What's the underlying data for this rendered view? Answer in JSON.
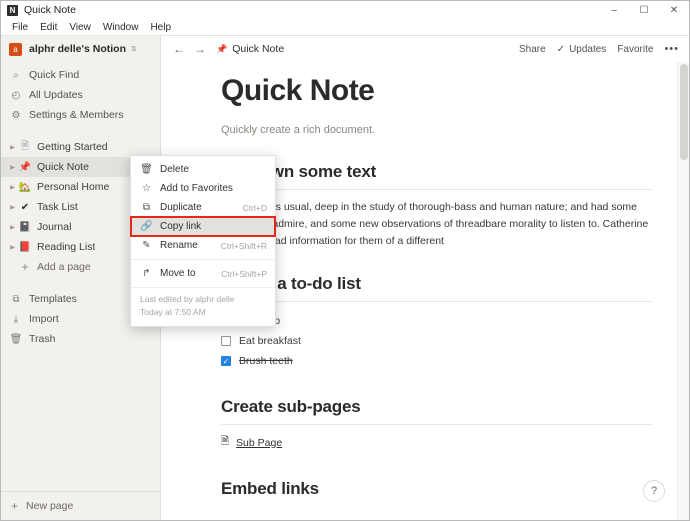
{
  "window": {
    "title": "Quick Note",
    "app_icon": "notion-logo-icon",
    "minimize": "–",
    "maximize": "☐",
    "close": "✕"
  },
  "menubar": {
    "items": [
      "File",
      "Edit",
      "View",
      "Window",
      "Help"
    ]
  },
  "sidebar": {
    "workspace": {
      "avatar_letter": "a",
      "avatar_color": "#d44e17",
      "name": "alphr delle's Notion",
      "chevron": "⇅"
    },
    "nav_items": [
      {
        "label": "Quick Find",
        "icon": "search-icon",
        "glyph": "⌕"
      },
      {
        "label": "All Updates",
        "icon": "clock-icon",
        "glyph": "◴"
      },
      {
        "label": "Settings & Members",
        "icon": "gear-icon",
        "glyph": "⚙"
      }
    ],
    "pages": [
      {
        "label": "Getting Started",
        "icon": "document-icon",
        "glyph": "🗎",
        "color": "#9aa0a6",
        "selected": false
      },
      {
        "label": "Quick Note",
        "icon": "pushpin-icon",
        "glyph": "📌",
        "color": "#d03030",
        "selected": true
      },
      {
        "label": "Personal Home",
        "icon": "house-icon",
        "glyph": "🏡",
        "color": "#c9a227",
        "selected": false
      },
      {
        "label": "Task List",
        "icon": "checkmark-icon",
        "glyph": "✔",
        "color": "#2c2b29",
        "selected": false
      },
      {
        "label": "Journal",
        "icon": "notebook-icon",
        "glyph": "📓",
        "color": "#5b6b8c",
        "selected": false
      },
      {
        "label": "Reading List",
        "icon": "red-book-icon",
        "glyph": "📕",
        "color": "#c0392b",
        "selected": false
      }
    ],
    "add_page": {
      "label": "Add a page",
      "icon": "plus-icon",
      "glyph": "+"
    },
    "footer_items": [
      {
        "label": "Templates",
        "icon": "templates-icon",
        "glyph": "⧉"
      },
      {
        "label": "Import",
        "icon": "import-icon",
        "glyph": "⤓"
      },
      {
        "label": "Trash",
        "icon": "trash-icon",
        "glyph": "🗑"
      }
    ],
    "new_page": {
      "label": "New page",
      "icon": "plus-icon",
      "glyph": "+"
    }
  },
  "topbar": {
    "back_icon": "arrow-left-icon",
    "back_glyph": "←",
    "forward_icon": "arrow-right-icon",
    "forward_glyph": "→",
    "breadcrumb": {
      "pin_icon": "pushpin-icon",
      "pin_glyph": "📌",
      "label": "Quick Note"
    },
    "actions": [
      {
        "label": "Share",
        "icon": "share-label",
        "glyph": ""
      },
      {
        "label": "Updates",
        "icon": "check-icon",
        "glyph": "✓"
      },
      {
        "label": "Favorite",
        "icon": "favorite-label",
        "glyph": ""
      }
    ],
    "more_glyph": "•••"
  },
  "document": {
    "title": "Quick Note",
    "subtitle": "Quickly create a rich document.",
    "sections": {
      "text_heading": "Jot down some text",
      "text_paragraph": "and Mary, as usual, deep in the study of thorough-bass and human nature; and had some extracts to admire, and some new observations of threadbare morality to listen to. Catherine and Lydia had information for them of a different",
      "todo_heading": "Create a to-do list",
      "todo_items": [
        {
          "label": "Wake up",
          "checked": false
        },
        {
          "label": "Eat breakfast",
          "checked": false
        },
        {
          "label": "Brush teeth",
          "checked": true
        }
      ],
      "subpages_heading": "Create sub-pages",
      "subpage": {
        "label": "Sub Page",
        "icon": "document-icon",
        "glyph": "🗎"
      },
      "embed_heading": "Embed links"
    },
    "checkbox_check_glyph": "✓",
    "accent_color": "#2383e2"
  },
  "context_menu": {
    "items": [
      {
        "label": "Delete",
        "icon": "trash-icon",
        "glyph": "🗑",
        "shortcut": "",
        "highlight": false,
        "separator_after": false
      },
      {
        "label": "Add to Favorites",
        "icon": "star-icon",
        "glyph": "☆",
        "shortcut": "",
        "highlight": false,
        "separator_after": false
      },
      {
        "label": "Duplicate",
        "icon": "duplicate-icon",
        "glyph": "⧉",
        "shortcut": "Ctrl+D",
        "highlight": false,
        "separator_after": false
      },
      {
        "label": "Copy link",
        "icon": "link-icon",
        "glyph": "🔗",
        "shortcut": "",
        "highlight": true,
        "separator_after": false
      },
      {
        "label": "Rename",
        "icon": "pencil-icon",
        "glyph": "✎",
        "shortcut": "Ctrl+Shift+R",
        "highlight": false,
        "separator_after": true
      },
      {
        "label": "Move to",
        "icon": "move-to-icon",
        "glyph": "↱",
        "shortcut": "Ctrl+Shift+P",
        "highlight": false,
        "separator_after": false
      }
    ],
    "footer": {
      "edited_by": "Last edited by alphr delle",
      "edited_time": "Today at 7:50 AM"
    },
    "highlight_color": "#e8261c"
  },
  "help_button": {
    "glyph": "?",
    "icon": "question-mark-icon"
  }
}
